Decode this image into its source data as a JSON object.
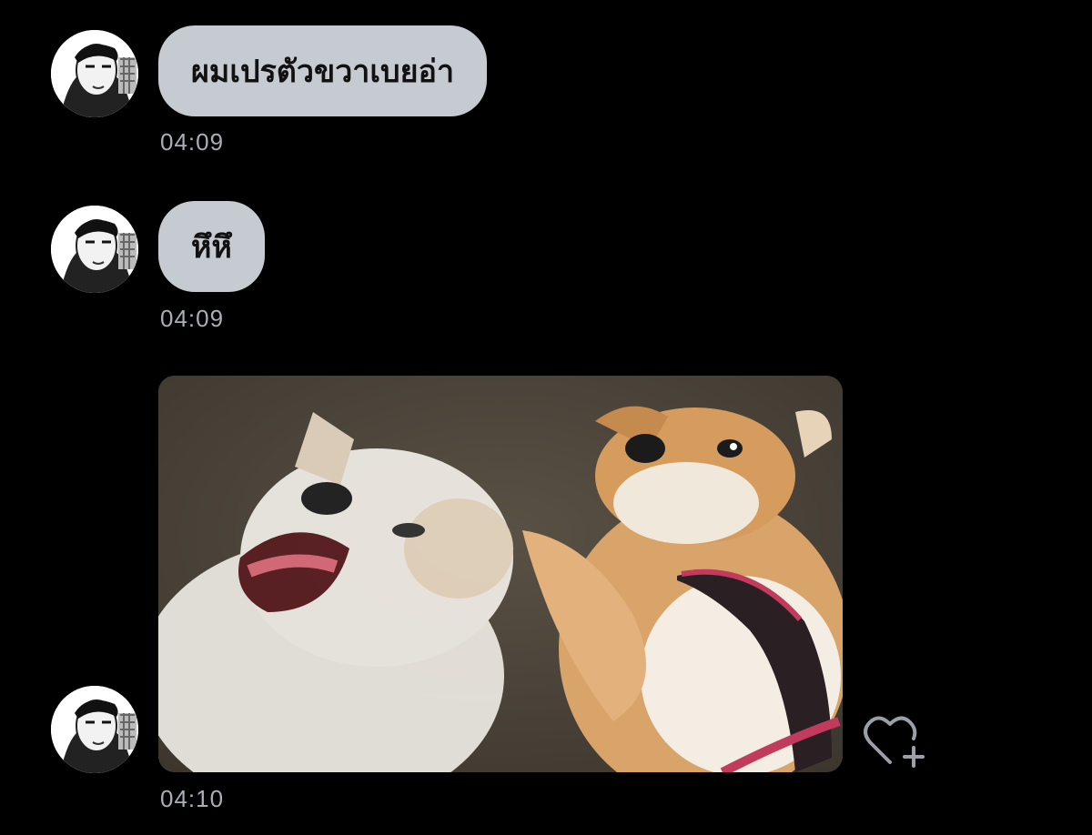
{
  "messages": [
    {
      "text": "ผมเปรตัวขวาเบยอ่า",
      "time": "04:09"
    },
    {
      "text": "หึหึ",
      "time": "04:09"
    },
    {
      "image": "two-dogs-playing-photo",
      "time": "04:10"
    }
  ],
  "icons": {
    "avatar": "avatar-icon",
    "react": "heart-plus-icon"
  },
  "colors": {
    "background": "#000000",
    "bubble": "#c6cbd2",
    "timestamp": "#a9aeb6"
  }
}
